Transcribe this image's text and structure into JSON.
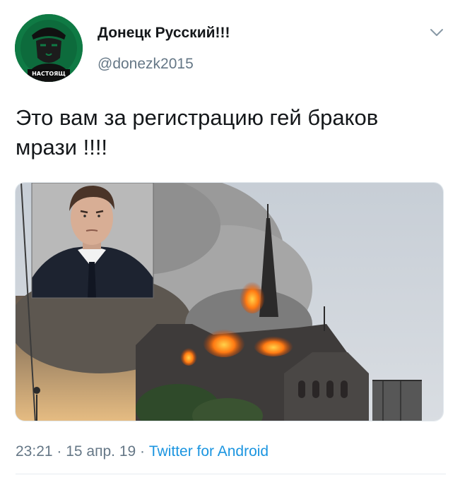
{
  "author": {
    "display_name": "Донецк Русский!!!",
    "handle": "@donezk2015",
    "avatar_caption": "НАСТОЯЩ"
  },
  "tweet": {
    "line1": "Это вам за регистрацию гей браков",
    "line2": "мрази !!!!"
  },
  "meta": {
    "time": "23:21",
    "separator1": " · ",
    "date": "15 апр. 19",
    "separator2": " · ",
    "source": "Twitter for Android"
  },
  "icons": {
    "menu": "chevron-down-icon"
  },
  "colors": {
    "text": "#14171a",
    "secondary": "#657786",
    "link": "#1b95e0",
    "avatar_bg": "#0d6f3f"
  }
}
